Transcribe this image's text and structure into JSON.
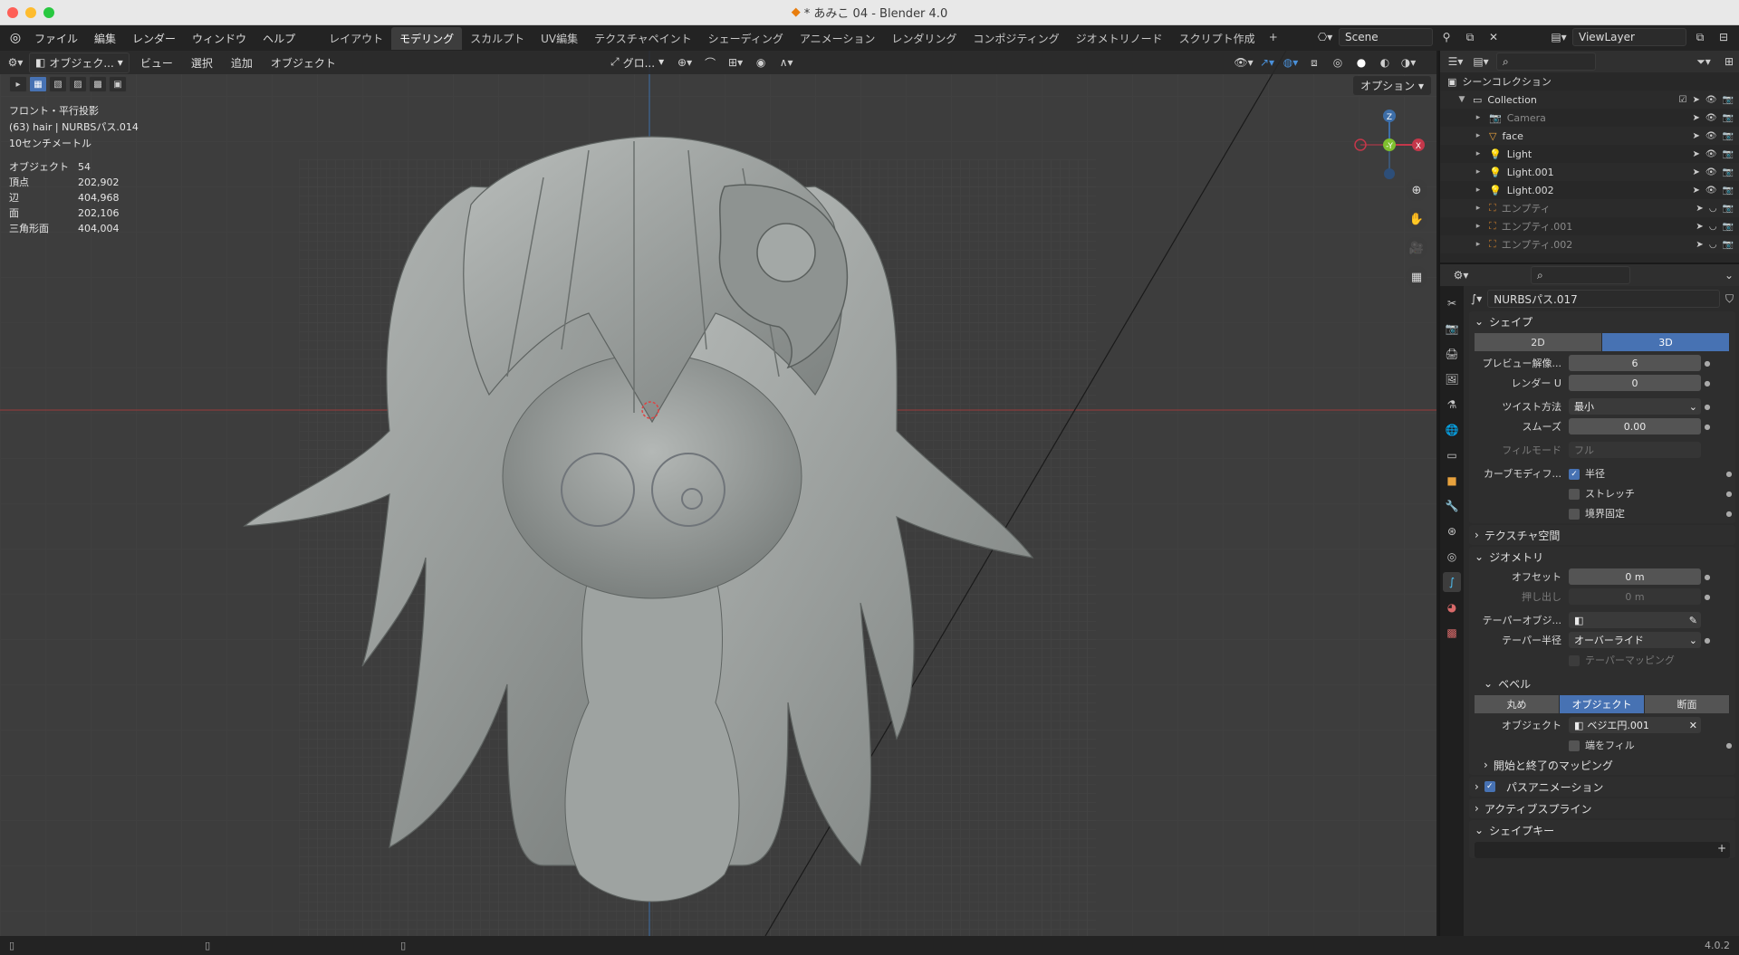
{
  "window": {
    "title": "* あみこ 04 - Blender 4.0",
    "file_icon": "blender-file-icon"
  },
  "menu": [
    "ファイル",
    "編集",
    "レンダー",
    "ウィンドウ",
    "ヘルプ"
  ],
  "workspaces": [
    "レイアウト",
    "モデリング",
    "スカルプト",
    "UV編集",
    "テクスチャペイント",
    "シェーディング",
    "アニメーション",
    "レンダリング",
    "コンポジティング",
    "ジオメトリノード",
    "スクリプト作成"
  ],
  "active_workspace_index": 1,
  "scene": {
    "name": "Scene",
    "view_layer": "ViewLayer"
  },
  "viewport": {
    "mode": "オブジェク...",
    "menus": [
      "ビュー",
      "選択",
      "追加",
      "オブジェクト"
    ],
    "transform_orientation": "グロ...",
    "options_label": "オプション",
    "view_info": [
      "フロント・平行投影",
      "(63) hair | NURBSパス.014",
      "10センチメートル"
    ],
    "stats": [
      {
        "k": "オブジェクト",
        "v": "54"
      },
      {
        "k": "頂点",
        "v": "202,902"
      },
      {
        "k": "辺",
        "v": "404,968"
      },
      {
        "k": "面",
        "v": "202,106"
      },
      {
        "k": "三角形面",
        "v": "404,004"
      }
    ],
    "gizmo_axes": {
      "z": "Z",
      "y": "-Y",
      "x": "X"
    }
  },
  "outliner": {
    "root": "シーンコレクション",
    "collection": "Collection",
    "items": [
      {
        "name": "Camera",
        "dim": true
      },
      {
        "name": "face",
        "dim": false
      },
      {
        "name": "Light",
        "dim": false
      },
      {
        "name": "Light.001",
        "dim": false
      },
      {
        "name": "Light.002",
        "dim": false
      },
      {
        "name": "エンプティ",
        "dim": true
      },
      {
        "name": "エンプティ.001",
        "dim": true
      },
      {
        "name": "エンプティ.002",
        "dim": true
      }
    ]
  },
  "properties": {
    "data_name": "NURBSパス.017",
    "shape": {
      "title": "シェイプ",
      "dim_2d": "2D",
      "dim_3d": "3D",
      "preview_label": "プレビュー解像...",
      "preview_value": "6",
      "render_label": "レンダー U",
      "render_value": "0",
      "twist_label": "ツイスト方法",
      "twist_value": "最小",
      "smooth_label": "スムーズ",
      "smooth_value": "0.00",
      "fill_label": "フィルモード",
      "fill_value": "フル",
      "curve_mod_label": "カーブモディフ...",
      "radius": "半径",
      "stretch": "ストレッチ",
      "bounds": "境界固定"
    },
    "texture_space": "テクスチャ空間",
    "geometry": {
      "title": "ジオメトリ",
      "offset_label": "オフセット",
      "offset_value": "0 m",
      "extrude_label": "押し出し",
      "extrude_value": "0 m",
      "taper_obj_label": "テーパーオブジ...",
      "taper_radius_label": "テーパー半径",
      "taper_radius_value": "オーバーライド",
      "taper_mapping": "テーパーマッピング"
    },
    "bevel": {
      "title": "ベベル",
      "round": "丸め",
      "object": "オブジェクト",
      "profile": "断面",
      "object_label": "オブジェクト",
      "object_value": "ベジエ円.001",
      "fill_caps": "端をフィル",
      "start_end": "開始と終了のマッピング"
    },
    "path_anim": "パスアニメーション",
    "active_spline": "アクティブスプライン",
    "shape_keys": "シェイプキー"
  },
  "status": {
    "version": "4.0.2"
  }
}
